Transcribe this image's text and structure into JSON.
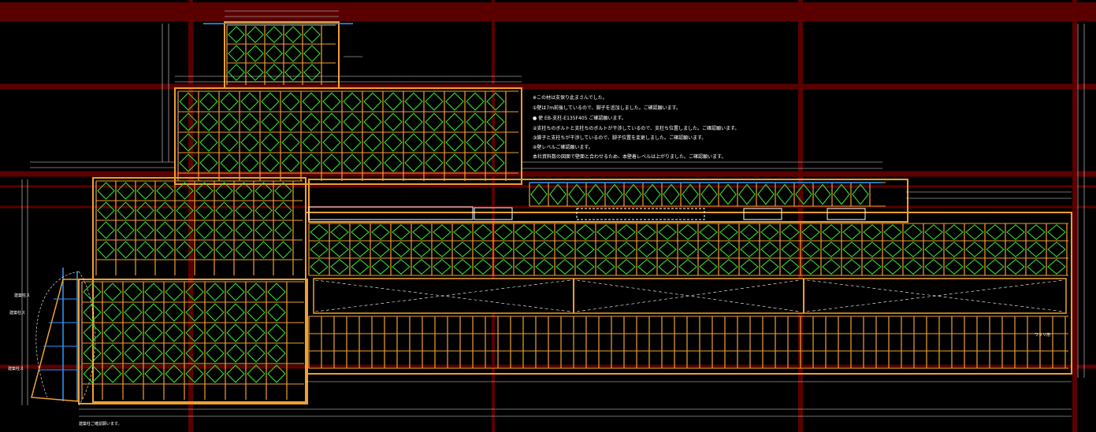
{
  "notes": {
    "lines": [
      "※この材は支保り此まさんでした。",
      "①壁は7m前後しているので、脚子を追加しました。ご確認願います。",
      "● 使 EB-支柱-E135F405 ご確認願います。",
      "②支柱ちのボルトと支柱ちのボルトが干渉しているので、支柱ち位置しました。ご確認願います。",
      "③脚子と支柱ちが干渉しているので、脚子位置を変更しました。ご確認願います。",
      "④壁レベルご確認願います。",
      "本社資料数の図面で壁面と合わせるため、本壁着レベルは上がりました。ご確認願います。"
    ]
  },
  "labels": {
    "left_1": "建築柱ス",
    "left_2": "建築柱ス",
    "left_3": "建築柱ス",
    "bottom_note": "建築柱ご確認願います。",
    "right_tag": "ワタリ用"
  },
  "colors": {
    "background": "#000000",
    "grid_line": "#5a0000",
    "beam": "#f0a030",
    "brace": "#33dd33",
    "accent_blue": "#3399ff",
    "dimension": "#dddddd"
  }
}
